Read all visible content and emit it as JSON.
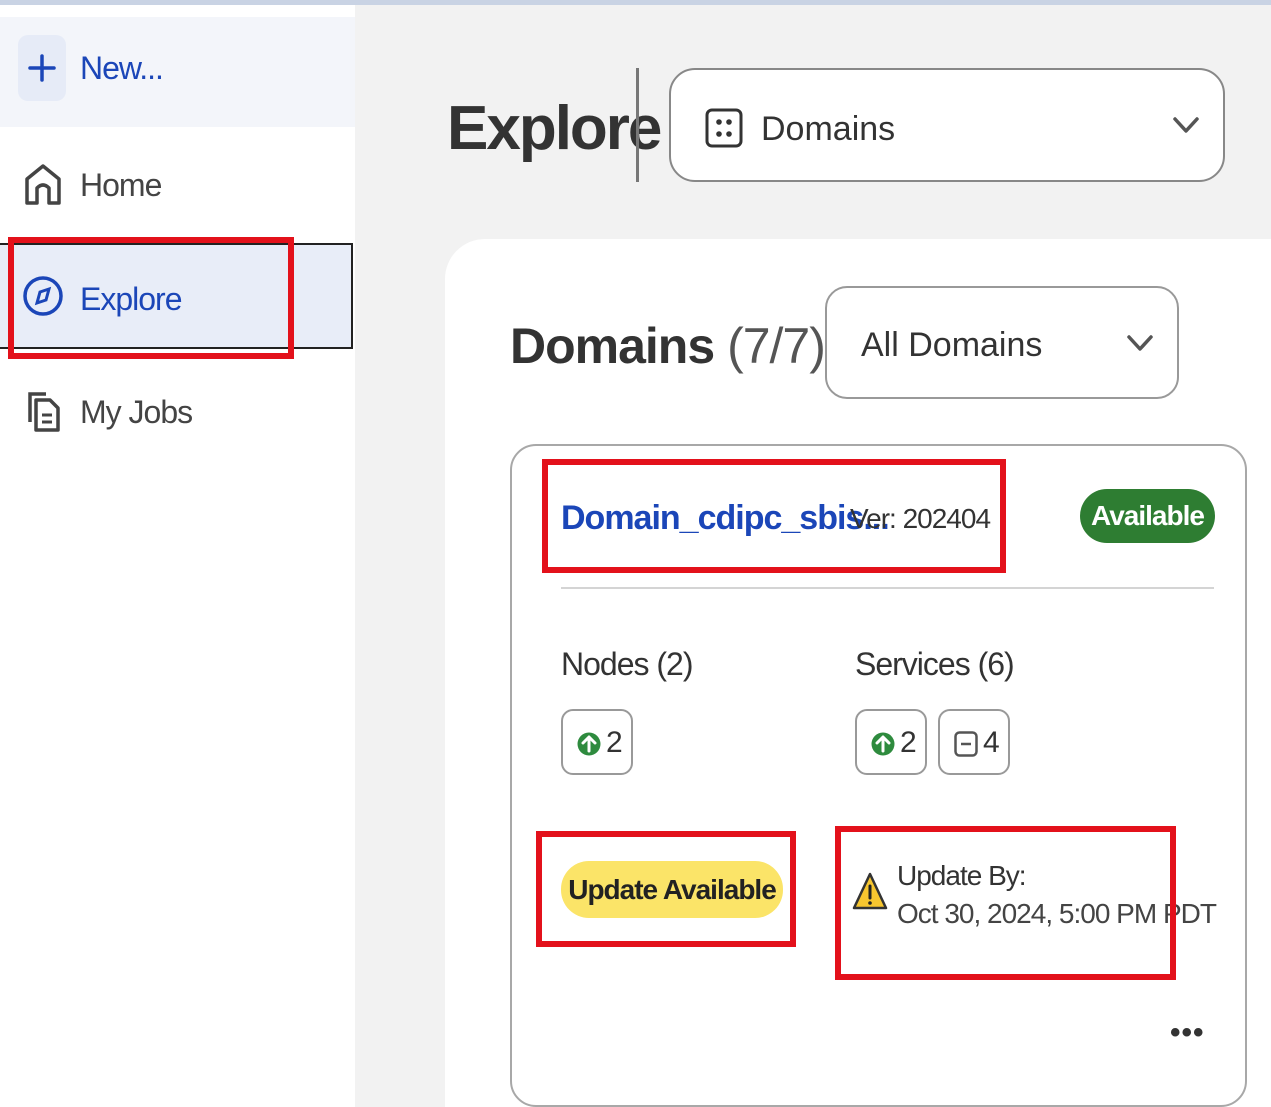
{
  "sidebar": {
    "new_label": "New...",
    "items": [
      {
        "label": "Home",
        "icon": "home-icon"
      },
      {
        "label": "Explore",
        "icon": "compass-icon"
      },
      {
        "label": "My Jobs",
        "icon": "documents-icon"
      }
    ]
  },
  "header": {
    "title": "Explore",
    "selector": {
      "label": "Domains",
      "icon": "domains-grid-icon"
    }
  },
  "panel": {
    "heading": "Domains",
    "count": "(7/7)",
    "filter": {
      "label": "All Domains"
    }
  },
  "card": {
    "name": "Domain_cdipc_sbis...",
    "version": "Ver: 202404",
    "status": "Available",
    "nodes": {
      "title": "Nodes (2)",
      "up": "2"
    },
    "services": {
      "title": "Services (6)",
      "up": "2",
      "disabled": "4"
    },
    "update_badge": "Update Available",
    "update_by_label": "Update By:",
    "update_by_date": "Oct 30, 2024, 5:00 PM PDT",
    "more": "•••"
  },
  "colors": {
    "accent": "#1b46b8",
    "available": "#2e7d32",
    "update": "#fbe468",
    "highlight": "#e3111b"
  }
}
